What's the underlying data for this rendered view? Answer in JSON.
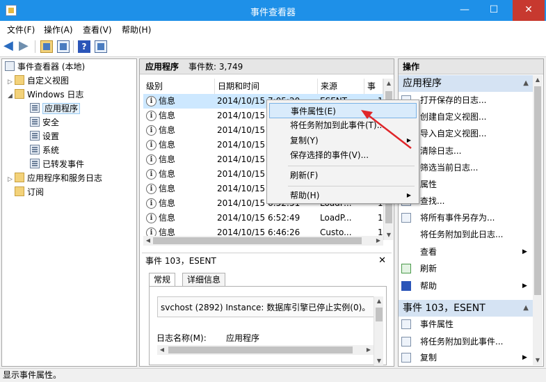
{
  "window": {
    "title": "事件查看器",
    "minimize": "—",
    "maximize": "☐",
    "close": "✕"
  },
  "menubar": [
    "文件(F)",
    "操作(A)",
    "查看(V)",
    "帮助(H)"
  ],
  "toolbar": {
    "back_icon": "back-arrow-icon",
    "forward_icon": "forward-arrow-icon",
    "help_glyph": "?"
  },
  "tree": {
    "root": "事件查看器 (本地)",
    "custom_views": "自定义视图",
    "windows_logs": "Windows 日志",
    "logs": [
      "应用程序",
      "安全",
      "设置",
      "系统",
      "已转发事件"
    ],
    "app_service_logs": "应用程序和服务日志",
    "subscriptions": "订阅"
  },
  "center": {
    "title": "应用程序",
    "event_count": "事件数: 3,749",
    "columns": [
      "级别",
      "日期和时间",
      "来源",
      "事件"
    ],
    "rows": [
      {
        "level": "信息",
        "datetime": "2014/10/15 7:05:20",
        "source": "ESENT",
        "id": "1"
      },
      {
        "level": "信息",
        "datetime": "2014/10/15",
        "source": "",
        "id": ""
      },
      {
        "level": "信息",
        "datetime": "2014/10/15",
        "source": "",
        "id": ""
      },
      {
        "level": "信息",
        "datetime": "2014/10/15",
        "source": "",
        "id": ""
      },
      {
        "level": "信息",
        "datetime": "2014/10/15",
        "source": "",
        "id": ""
      },
      {
        "level": "信息",
        "datetime": "2014/10/15",
        "source": "",
        "id": ""
      },
      {
        "level": "信息",
        "datetime": "2014/10/15",
        "source": "",
        "id": ""
      },
      {
        "level": "信息",
        "datetime": "2014/10/15 6:52:51",
        "source": "LoadP...",
        "id": "1"
      },
      {
        "level": "信息",
        "datetime": "2014/10/15 6:52:49",
        "source": "LoadP...",
        "id": "1"
      },
      {
        "level": "信息",
        "datetime": "2014/10/15 6:46:26",
        "source": "Custo...",
        "id": "1"
      }
    ]
  },
  "detail": {
    "title": "事件 103，ESENT",
    "close": "✕",
    "tabs": [
      "常规",
      "详细信息"
    ],
    "message": "svchost (2892) Instance: 数据库引擎已停止实例(0)。",
    "log_name_label": "日志名称(M):",
    "log_name_value": "应用程序"
  },
  "context_menu": {
    "items": [
      {
        "label": "事件属性(E)",
        "highlight": true
      },
      {
        "label": "将任务附加到此事件(T)..."
      },
      {
        "label": "复制(Y)",
        "submenu": true
      },
      {
        "label": "保存选择的事件(V)..."
      },
      {
        "label": "刷新(F)"
      },
      {
        "label": "帮助(H)",
        "submenu": true
      }
    ]
  },
  "actions": {
    "title": "操作",
    "section1": "应用程序",
    "section1_items": [
      {
        "label": "打开保存的日志...",
        "icon": "open-folder-icon"
      },
      {
        "label": "创建自定义视图...",
        "icon": "filter-icon"
      },
      {
        "label": "导入自定义视图...",
        "icon": "import-icon"
      },
      {
        "label": "清除日志...",
        "icon": "clear-log-icon"
      },
      {
        "label": "筛选当前日志...",
        "icon": "filter-icon"
      },
      {
        "label": "属性",
        "icon": "properties-icon"
      },
      {
        "label": "查找...",
        "icon": "find-icon"
      },
      {
        "label": "将所有事件另存为...",
        "icon": "save-icon"
      },
      {
        "label": "将任务附加到此日志...",
        "icon": "attach-task-icon"
      },
      {
        "label": "查看",
        "icon": "view-icon",
        "submenu": true
      },
      {
        "label": "刷新",
        "icon": "refresh-icon"
      },
      {
        "label": "帮助",
        "icon": "help-icon",
        "submenu": true
      }
    ],
    "section2": "事件 103，ESENT",
    "section2_items": [
      {
        "label": "事件属性",
        "icon": "properties-icon"
      },
      {
        "label": "将任务附加到此事件...",
        "icon": "attach-task-icon"
      },
      {
        "label": "复制",
        "icon": "copy-icon",
        "submenu": true
      }
    ]
  },
  "statusbar": "显示事件属性。",
  "colors": {
    "titlebar": "#1e90e8",
    "selection": "#cde8ff",
    "section_header": "#d5e3f3",
    "annotation_arrow": "#e0262a"
  }
}
